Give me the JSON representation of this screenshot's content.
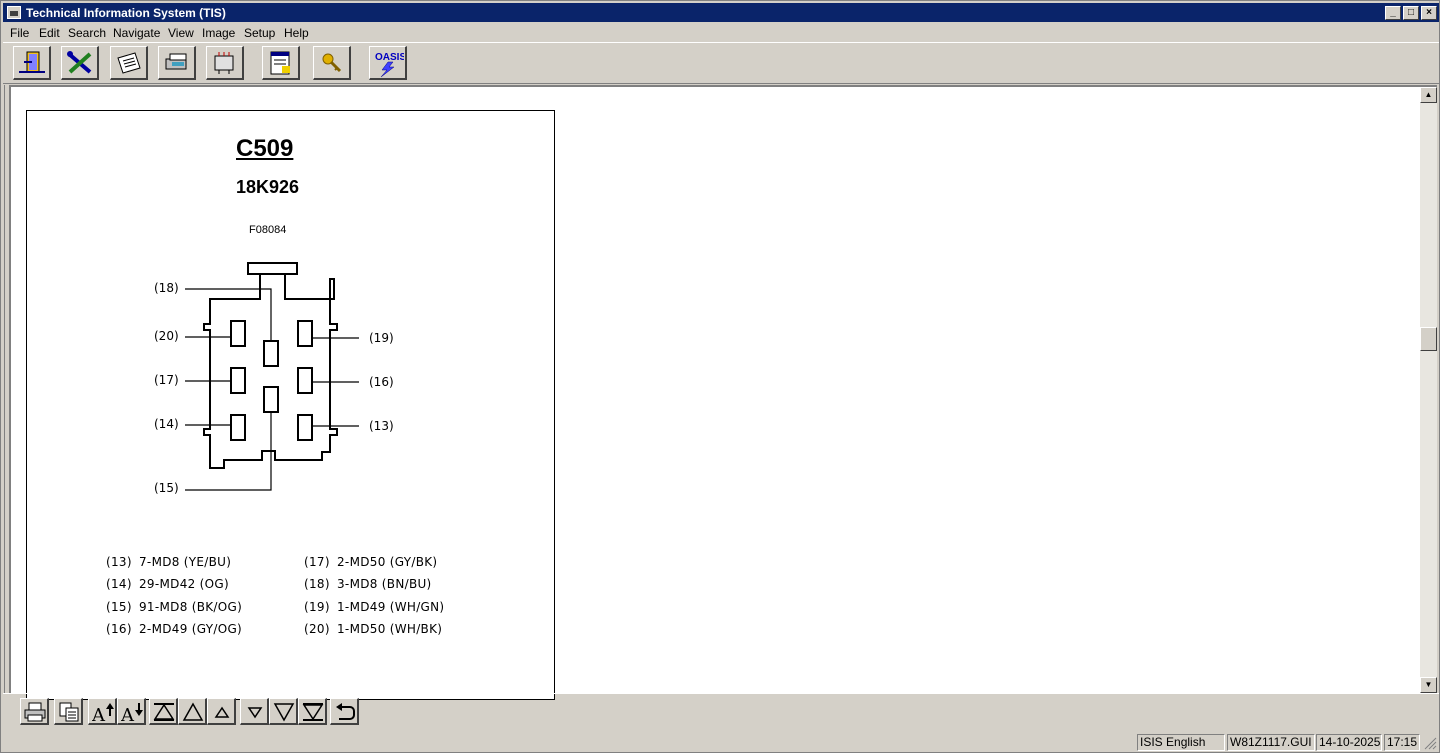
{
  "window": {
    "title": "Technical Information System (TIS)"
  },
  "menu": [
    "File",
    "Edit",
    "Search",
    "Navigate",
    "View",
    "Image",
    "Setup",
    "Help"
  ],
  "toolbar": {
    "icons": [
      "exit-door-icon",
      "tools-icon",
      "document-icon",
      "vehicle-icon",
      "module-icon",
      "printer-list-icon",
      "key-icon",
      "oasis-icon"
    ],
    "oasis_label": "OASIS"
  },
  "document": {
    "connector": "C509",
    "part_number": "18K926",
    "figure_id": "F08084",
    "pins_left": [
      "(18)",
      "(20)",
      "(17)",
      "(14)",
      "(15)"
    ],
    "pins_right": [
      "(19)",
      "(16)",
      "(13)"
    ],
    "legend_left": [
      {
        "num": "(13)",
        "wire": "7-MD8 (YE/BU)"
      },
      {
        "num": "(14)",
        "wire": "29-MD42 (OG)"
      },
      {
        "num": "(15)",
        "wire": "91-MD8 (BK/OG)"
      },
      {
        "num": "(16)",
        "wire": "2-MD49 (GY/OG)"
      }
    ],
    "legend_right": [
      {
        "num": "(17)",
        "wire": "2-MD50 (GY/BK)"
      },
      {
        "num": "(18)",
        "wire": "3-MD8 (BN/BU)"
      },
      {
        "num": "(19)",
        "wire": "1-MD49 (WH/GN)"
      },
      {
        "num": "(20)",
        "wire": "1-MD50 (WH/BK)"
      }
    ]
  },
  "bottom_toolbar": [
    "print-icon",
    "copy-icon",
    "font-larger-icon",
    "font-smaller-icon",
    "first-page-icon",
    "page-up-icon",
    "line-up-icon",
    "line-down-icon",
    "page-down-icon",
    "last-page-icon",
    "back-icon"
  ],
  "status": {
    "language": "ISIS English",
    "file": "W81Z1117.GUI",
    "date": "14-10-2025",
    "time": "17:15"
  }
}
